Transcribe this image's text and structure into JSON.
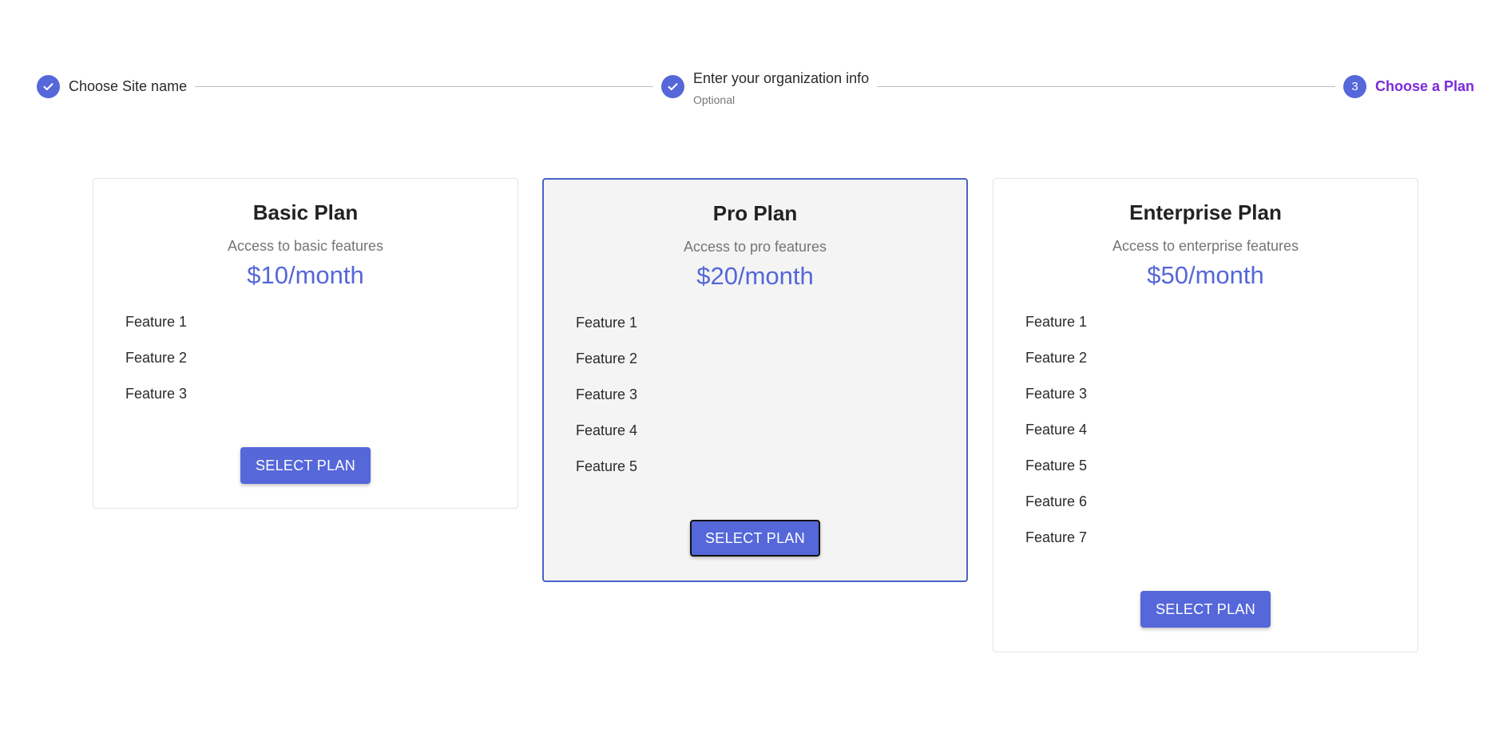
{
  "stepper": {
    "steps": [
      {
        "label": "Choose Site name",
        "status": "completed",
        "icon": "check-icon"
      },
      {
        "label": "Enter your organization info",
        "optional": "Optional",
        "status": "completed",
        "icon": "check-icon"
      },
      {
        "label": "Choose a Plan",
        "number": "3",
        "status": "active"
      }
    ]
  },
  "plans": [
    {
      "title": "Basic Plan",
      "description": "Access to basic features",
      "price": "$10/month",
      "features": [
        "Feature 1",
        "Feature 2",
        "Feature 3"
      ],
      "button": "SELECT PLAN",
      "selected": false
    },
    {
      "title": "Pro Plan",
      "description": "Access to pro features",
      "price": "$20/month",
      "features": [
        "Feature 1",
        "Feature 2",
        "Feature 3",
        "Feature 4",
        "Feature 5"
      ],
      "button": "SELECT PLAN",
      "selected": true
    },
    {
      "title": "Enterprise Plan",
      "description": "Access to enterprise features",
      "price": "$50/month",
      "features": [
        "Feature 1",
        "Feature 2",
        "Feature 3",
        "Feature 4",
        "Feature 5",
        "Feature 6",
        "Feature 7"
      ],
      "button": "SELECT PLAN",
      "selected": false
    }
  ],
  "colors": {
    "primary": "#5567d9",
    "active_step": "#7b2ad9",
    "selected_border": "#4a63c9"
  }
}
